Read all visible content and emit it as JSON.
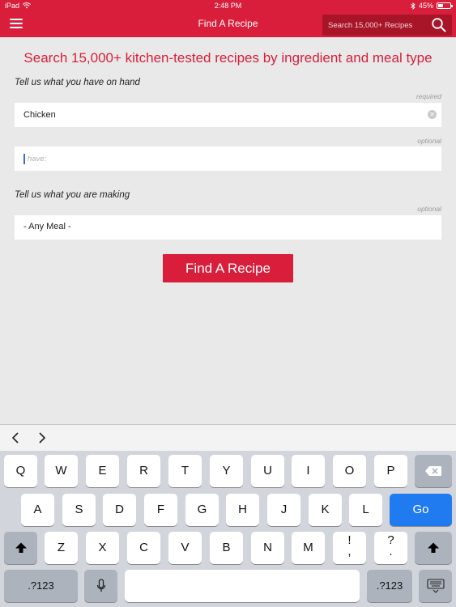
{
  "status": {
    "device": "iPad",
    "time": "2:48 PM",
    "battery": "45%",
    "battery_level": 0.45
  },
  "nav": {
    "title": "Find A Recipe",
    "search_placeholder": "Search 15,000+ Recipes"
  },
  "headline": "Search 15,000+ kitchen-tested recipes by ingredient and meal type",
  "form": {
    "have_label": "Tell us what you have on hand",
    "required_hint": "required",
    "ingredient1_value": "Chicken",
    "optional_hint": "optional",
    "ingredient2_placeholder": "have:",
    "making_label": "Tell us what you are making",
    "making_optional_hint": "optional",
    "meal_value": "- Any Meal -",
    "submit_label": "Find A Recipe"
  },
  "keyboard": {
    "row1": [
      "Q",
      "W",
      "E",
      "R",
      "T",
      "Y",
      "U",
      "I",
      "O",
      "P"
    ],
    "row2": [
      "A",
      "S",
      "D",
      "F",
      "G",
      "H",
      "J",
      "K",
      "L"
    ],
    "row3": [
      "Z",
      "X",
      "C",
      "V",
      "B",
      "N",
      "M"
    ],
    "punct1": [
      "!",
      ","
    ],
    "punct2": [
      "?",
      "."
    ],
    "go_label": "Go",
    "numbers_label": ".?123",
    "numbers_label_right": ".?123"
  },
  "colors": {
    "brand": "#d81e3a",
    "go_key": "#1f7bef"
  }
}
